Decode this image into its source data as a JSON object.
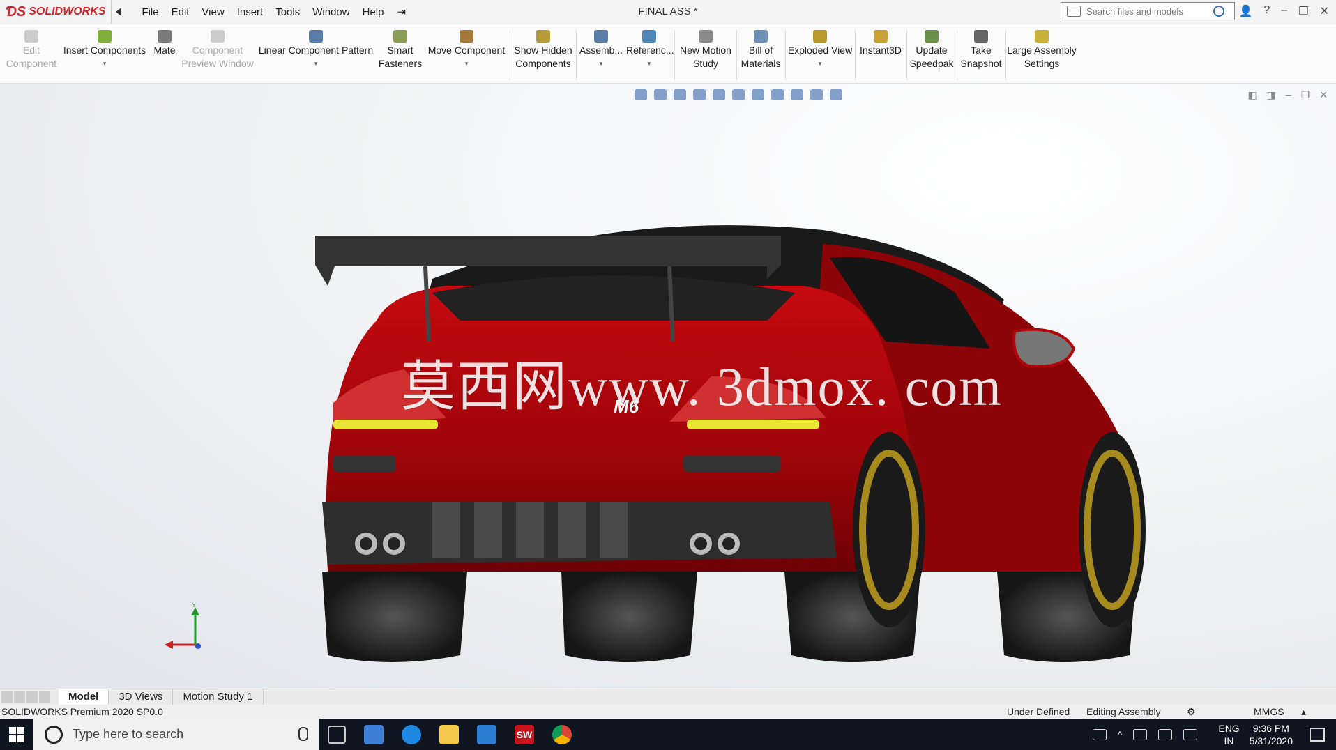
{
  "app": {
    "brand": "SOLIDWORKS",
    "document_title": "FINAL ASS *",
    "menu": [
      "File",
      "Edit",
      "View",
      "Insert",
      "Tools",
      "Window",
      "Help"
    ],
    "search_placeholder": "Search files and models"
  },
  "toolbar": {
    "items": [
      {
        "label_1": "Edit",
        "label_2": "Component",
        "enabled": false
      },
      {
        "label_1": "Insert Components",
        "label_2": "",
        "enabled": true
      },
      {
        "label_1": "",
        "label_2": "Mate",
        "enabled": true
      },
      {
        "label_1": "Component",
        "label_2": "Preview Window",
        "enabled": false
      },
      {
        "label_1": "Linear Component Pattern",
        "label_2": "",
        "enabled": true
      },
      {
        "label_1": "Smart",
        "label_2": "Fasteners",
        "enabled": true
      },
      {
        "label_1": "Move Component",
        "label_2": "",
        "enabled": true
      },
      {
        "label_1": "Show Hidden",
        "label_2": "Components",
        "enabled": true
      },
      {
        "label_1": "Assemb...",
        "label_2": "",
        "enabled": true
      },
      {
        "label_1": "Referenc...",
        "label_2": "",
        "enabled": true
      },
      {
        "label_1": "New Motion",
        "label_2": "Study",
        "enabled": true
      },
      {
        "label_1": "Bill of",
        "label_2": "Materials",
        "enabled": true
      },
      {
        "label_1": "Exploded View",
        "label_2": "",
        "enabled": true
      },
      {
        "label_1": "",
        "label_2": "Instant3D",
        "enabled": true
      },
      {
        "label_1": "Update",
        "label_2": "Speedpak",
        "enabled": true
      },
      {
        "label_1": "Take",
        "label_2": "Snapshot",
        "enabled": true
      },
      {
        "label_1": "Large Assembly",
        "label_2": "Settings",
        "enabled": true
      }
    ]
  },
  "viewport": {
    "watermark": "莫西网www. 3dmox. com",
    "car_badge": "M6",
    "triad_y_label": "Y"
  },
  "tabs": {
    "model": "Model",
    "views_3d": "3D Views",
    "motion_study": "Motion Study 1"
  },
  "status": {
    "product": "SOLIDWORKS Premium 2020 SP0.0",
    "definition": "Under Defined",
    "mode": "Editing Assembly",
    "units": "MMGS"
  },
  "taskbar": {
    "search_placeholder": "Type here to search",
    "lang_1": "ENG",
    "lang_2": "IN",
    "time": "9:36 PM",
    "date": "5/31/2020",
    "sw_badge": "SW"
  },
  "colors": {
    "brand_red": "#d2232a",
    "car_red": "#b0060b",
    "wheel_gold": "#a88b1e"
  }
}
